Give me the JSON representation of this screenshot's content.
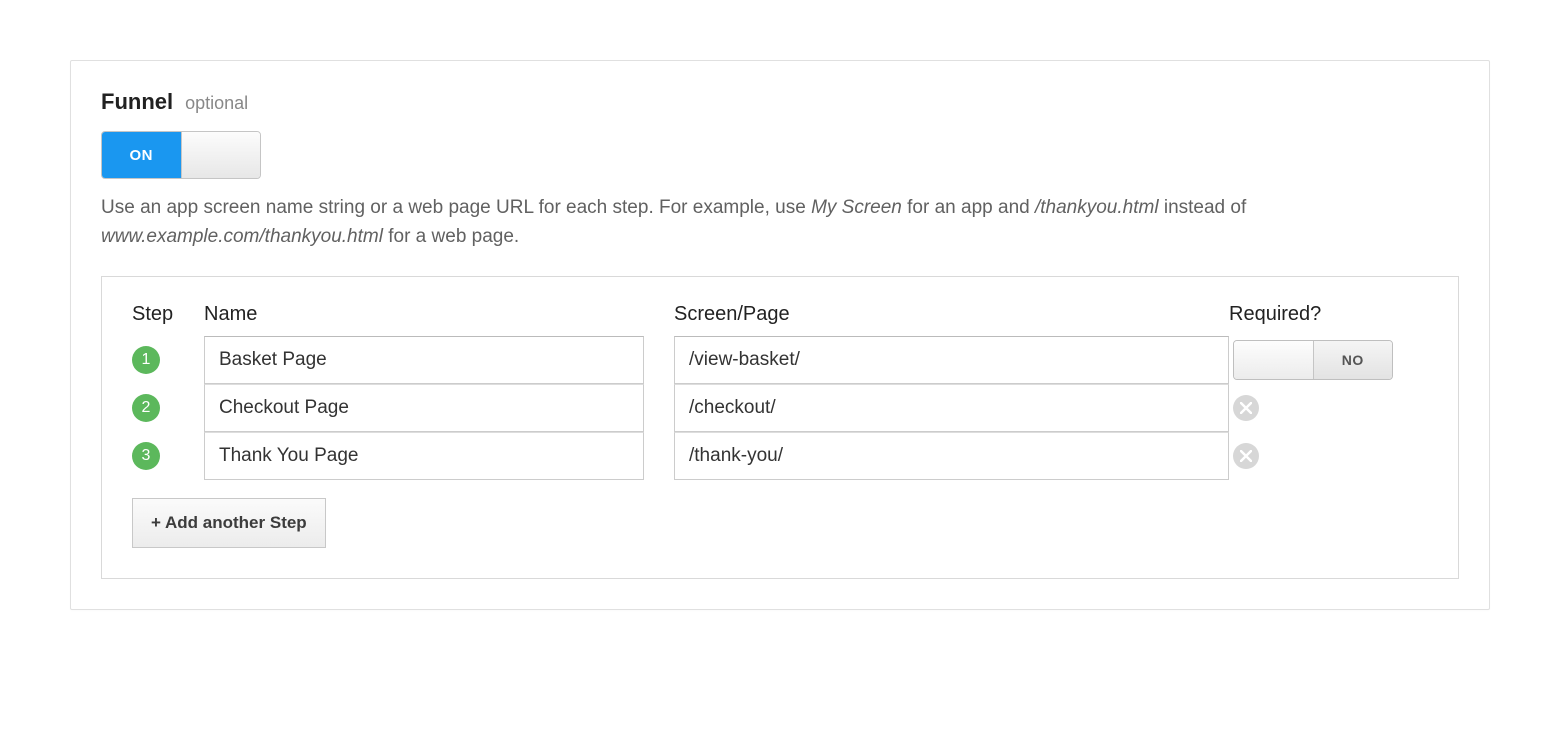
{
  "section": {
    "title": "Funnel",
    "subtitle": "optional",
    "toggle_on": "ON",
    "description": {
      "pre1": "Use an app screen name string or a web page URL for each step. For example, use ",
      "ex1": "My Screen",
      "mid1": " for an app and ",
      "ex2": "/thankyou.html",
      "mid2": " instead of ",
      "ex3": "www.example.com/thankyou.html",
      "post": " for a web page."
    }
  },
  "headers": {
    "step": "Step",
    "name": "Name",
    "screen": "Screen/Page",
    "required": "Required?"
  },
  "steps": [
    {
      "num": "1",
      "name": "Basket Page",
      "screen": "/view-basket/",
      "required_label": "NO",
      "has_required_toggle": true
    },
    {
      "num": "2",
      "name": "Checkout Page",
      "screen": "/checkout/",
      "has_required_toggle": false
    },
    {
      "num": "3",
      "name": "Thank You Page",
      "screen": "/thank-you/",
      "has_required_toggle": false
    }
  ],
  "add_button": "+ Add another Step"
}
